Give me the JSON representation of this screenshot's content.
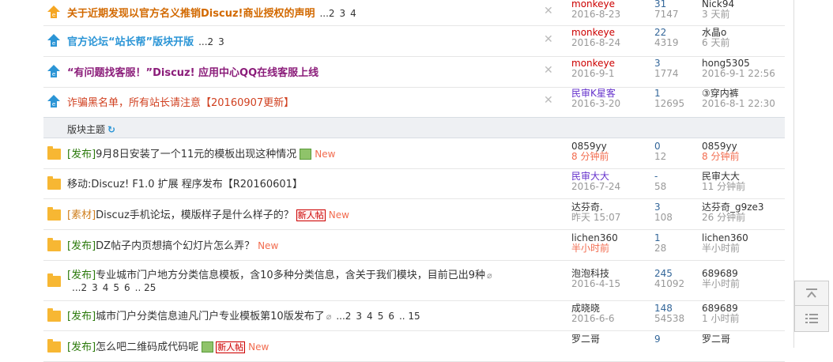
{
  "pinned": [
    {
      "title": "关于近期发现以官方名义推销Discuz!商业授权的声明",
      "style": "t-orange",
      "icon": "orange",
      "pages": [
        "...2",
        "3",
        "4"
      ],
      "author": "monkeye",
      "author_color": "red",
      "date": "2016-8-23",
      "replies": "31",
      "views": "7147",
      "last_user": "Nick94",
      "last_time": "3 天前"
    },
    {
      "title": "官方论坛“站长帮”版块开版",
      "style": "t-blue",
      "icon": "blue",
      "pages": [
        "...2",
        "3"
      ],
      "author": "monkeye",
      "author_color": "red",
      "date": "2016-8-24",
      "replies": "22",
      "views": "4319",
      "last_user": "水晶o",
      "last_time": "6 天前"
    },
    {
      "title": "“有问题找客服！”Discuz! 应用中心QQ在线客服上线",
      "style": "t-purple",
      "icon": "blue",
      "pages": [],
      "author": "monkeye",
      "author_color": "red",
      "date": "2016-9-1",
      "replies": "3",
      "views": "1774",
      "last_user": "hong5305",
      "last_time": "2016-9-1 22:56"
    },
    {
      "title": "诈骗黑名单，所有站长请注意【20160907更新】",
      "style": "t-red",
      "icon": "blue",
      "pages": [],
      "author": "民审K星客",
      "author_color": "purple",
      "date": "2016-3-20",
      "replies": "1",
      "views": "12695",
      "last_user": "③穿内裤",
      "last_time": "2016-8-1 22:30"
    }
  ],
  "section": {
    "label": "版块主题",
    "refresh": "↻"
  },
  "threads": [
    {
      "tag": "[发布]",
      "tag_style": "tag",
      "title": "9月8日安装了一个11元的模板出现这种情况",
      "image": true,
      "clip": false,
      "xin": "",
      "new": "New",
      "pages": [],
      "author": "0859yy",
      "author_color": "dark",
      "date": "8 分钟前",
      "date_color": "orange",
      "replies": "0",
      "views": "12",
      "last_user": "0859yy",
      "last_time": "8 分钟前",
      "last_color": "orange"
    },
    {
      "tag": "",
      "tag_style": "tag",
      "title": "移动:Discuz! F1.0 扩展 程序发布【R20160601】",
      "image": false,
      "clip": false,
      "xin": "",
      "new": "",
      "pages": [],
      "author": "民审大大",
      "author_color": "purple",
      "date": "2016-7-24",
      "date_color": "gray",
      "replies": "-",
      "views": "58",
      "last_user": "民审大大",
      "last_time": "11 分钟前",
      "last_color": "gray"
    },
    {
      "tag": "[素材]",
      "tag_style": "tag-orange",
      "title": "Discuz手机论坛，模版样子是什么样子的？",
      "image": false,
      "clip": false,
      "xin": "新人帖",
      "new": "New",
      "pages": [],
      "author": "达芬奇.",
      "author_color": "dark",
      "date": "昨天 15:07",
      "date_color": "gray",
      "replies": "3",
      "views": "108",
      "last_user": "达芬奇_g9ze3",
      "last_time": "26 分钟前",
      "last_color": "gray"
    },
    {
      "tag": "[发布]",
      "tag_style": "tag",
      "title": "DZ帖子内页想搞个幻灯片怎么弄？",
      "image": false,
      "clip": false,
      "xin": "",
      "new": "New",
      "pages": [],
      "author": "lichen360",
      "author_color": "dark",
      "date": "半小时前",
      "date_color": "orange",
      "replies": "1",
      "views": "28",
      "last_user": "lichen360",
      "last_time": "半小时前",
      "last_color": "gray"
    },
    {
      "tag": "[发布]",
      "tag_style": "tag",
      "title": "专业城市门户地方分类信息模板，含10多种分类信息，含关于我们模块，目前已出9种",
      "image": false,
      "clip": true,
      "xin": "",
      "new": "",
      "pages": [
        "...2",
        "3",
        "4",
        "5",
        "6",
        ".. 25"
      ],
      "author": "泡泡科技",
      "author_color": "dark",
      "date": "2016-4-15",
      "date_color": "gray",
      "replies": "245",
      "views": "41092",
      "last_user": "689689",
      "last_time": "半小时前",
      "last_color": "gray"
    },
    {
      "tag": "[发布]",
      "tag_style": "tag",
      "title": "城市门户分类信息迪凡门户专业模板第10版发布了",
      "image": false,
      "clip": true,
      "xin": "",
      "new": "",
      "pages": [
        "...2",
        "3",
        "4",
        "5",
        "6",
        ".. 15"
      ],
      "author": "成晓晓",
      "author_color": "dark",
      "date": "2016-6-6",
      "date_color": "gray",
      "replies": "148",
      "views": "54538",
      "last_user": "689689",
      "last_time": "1 小时前",
      "last_color": "gray"
    },
    {
      "tag": "[发布]",
      "tag_style": "tag",
      "title": "怎么吧二维码成代码呢",
      "image": true,
      "clip": false,
      "xin": "新人帖",
      "new": "New",
      "pages": [],
      "author": "罗二哥",
      "author_color": "dark",
      "date": "",
      "date_color": "gray",
      "replies": "9",
      "views": "",
      "last_user": "罗二哥",
      "last_time": "",
      "last_color": "gray"
    }
  ],
  "side": {
    "top_icon": "back-to-top-icon",
    "list_icon": "list-icon"
  }
}
